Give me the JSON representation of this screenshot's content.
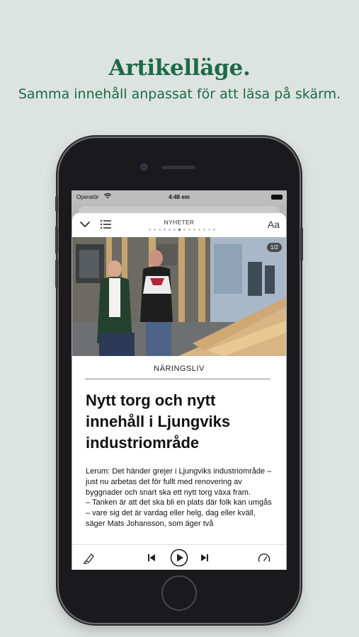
{
  "promo": {
    "title": "Artikelläge.",
    "subtitle": "Samma innehåll anpassat för att läsa på skärm."
  },
  "status_bar": {
    "operator": "Operatör",
    "time": "4:48 em",
    "icons": [
      "wifi-icon",
      "battery-icon"
    ]
  },
  "top_bar": {
    "section": "NYHETER",
    "text_size_label": "Aa",
    "page_dots": {
      "count": 14,
      "active_index": 6
    },
    "icons": [
      "chevron-down-icon",
      "list-icon"
    ]
  },
  "article": {
    "photo_counter": "1/2",
    "category": "NÄRINGSLIV",
    "title": "Nytt torg och nytt innehåll i Ljungviks industriområde",
    "body": "Lerum: Det händer grejer i Ljungviks industriområde – just nu arbetas det för fullt med renovering av byggnader och snart ska ett nytt torg växa fram.\n– Tanken är att det ska bli en plats där folk kan umgås – vare sig det är vardag eller helg, dag eller kväll, säger Mats Johansson, som äger två"
  },
  "bottom_bar": {
    "icons": [
      "highlighter-icon",
      "skip-back-icon",
      "play-icon",
      "skip-forward-icon",
      "speed-gauge-icon"
    ]
  },
  "colors": {
    "background": "#dde3e1",
    "accent_green": "#1e6a48"
  }
}
